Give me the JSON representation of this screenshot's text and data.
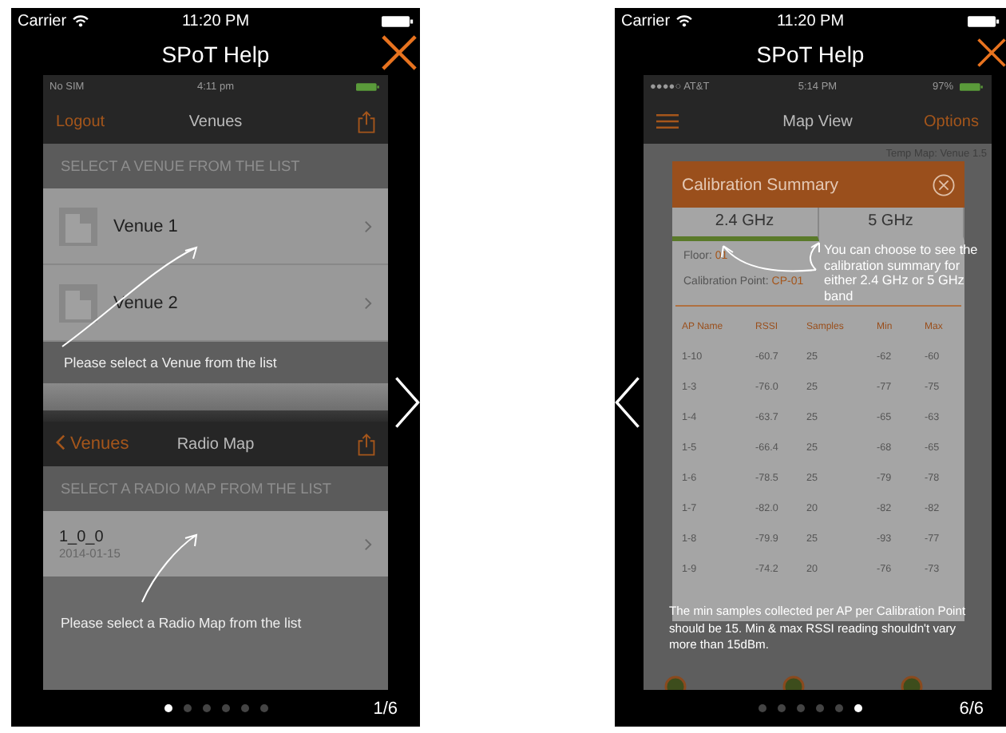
{
  "help_pages": [
    {
      "kind": "venues",
      "status_bar": {
        "carrier": "Carrier",
        "time": "11:20 PM"
      },
      "title": "SPoT Help",
      "screen": {
        "status_bar": {
          "carrier": "No SIM",
          "time": "4:11 pm"
        },
        "nav_bar": {
          "left": "Logout",
          "title": "Venues"
        },
        "section_header": "SELECT A VENUE FROM THE LIST",
        "venues": [
          "Venue 1",
          "Venue 2"
        ],
        "hint": "Please select a Venue from the list",
        "nav_bar_2": {
          "back": "Venues",
          "title": "Radio Map"
        },
        "section_header_2": "SELECT A RADIO MAP FROM THE LIST",
        "radio_maps": [
          {
            "name": "1_0_0",
            "date": "2014-01-15"
          }
        ],
        "hint_2": "Please select a Radio Map from the list"
      },
      "page_dots": [
        {
          "selected": true
        },
        {
          "selected": false
        },
        {
          "selected": false
        },
        {
          "selected": false
        },
        {
          "selected": false
        },
        {
          "selected": false
        }
      ],
      "counter": "1/6"
    },
    {
      "kind": "map",
      "status_bar": {
        "carrier": "Carrier",
        "time": "11:20 PM"
      },
      "title": "SPoT Help",
      "screen": {
        "status_bar": {
          "carrier": "●●●●○ AT&T",
          "time": "5:14 PM",
          "battery": "97%"
        },
        "nav_bar": {
          "title": "Map View",
          "right": "Options"
        },
        "map_label": "Temp Map: Venue 1.5",
        "dialog": {
          "title": "Calibration Summary",
          "tabs": [
            {
              "label": "2.4 GHz",
              "selected": true
            },
            {
              "label": "5 GHz",
              "selected": false
            }
          ],
          "floor_label": "Floor:",
          "floor": "01",
          "point_label": "Calibration Point:",
          "point": "CP-01",
          "columns": [
            "AP Name",
            "RSSI",
            "Samples",
            "Min",
            "Max"
          ],
          "rows": [
            [
              "1-10",
              "-60.7",
              "25",
              "-62",
              "-60"
            ],
            [
              "1-3",
              "-76.0",
              "25",
              "-77",
              "-75"
            ],
            [
              "1-4",
              "-63.7",
              "25",
              "-65",
              "-63"
            ],
            [
              "1-5",
              "-66.4",
              "25",
              "-68",
              "-65"
            ],
            [
              "1-6",
              "-78.5",
              "25",
              "-79",
              "-78"
            ],
            [
              "1-7",
              "-82.0",
              "20",
              "-82",
              "-82"
            ],
            [
              "1-8",
              "-79.9",
              "25",
              "-93",
              "-77"
            ],
            [
              "1-9",
              "-74.2",
              "20",
              "-76",
              "-73"
            ]
          ]
        },
        "hint": "You can choose to see the calibration summary for either 2.4 GHz or 5 GHz band",
        "note": "The min samples collected per AP per Calibration Point should be 15. Min & max RSSI reading shouldn't vary more than 15dBm."
      },
      "page_dots": [
        {
          "selected": false
        },
        {
          "selected": false
        },
        {
          "selected": false
        },
        {
          "selected": false
        },
        {
          "selected": false
        },
        {
          "selected": true
        }
      ],
      "counter": "6/6"
    }
  ]
}
